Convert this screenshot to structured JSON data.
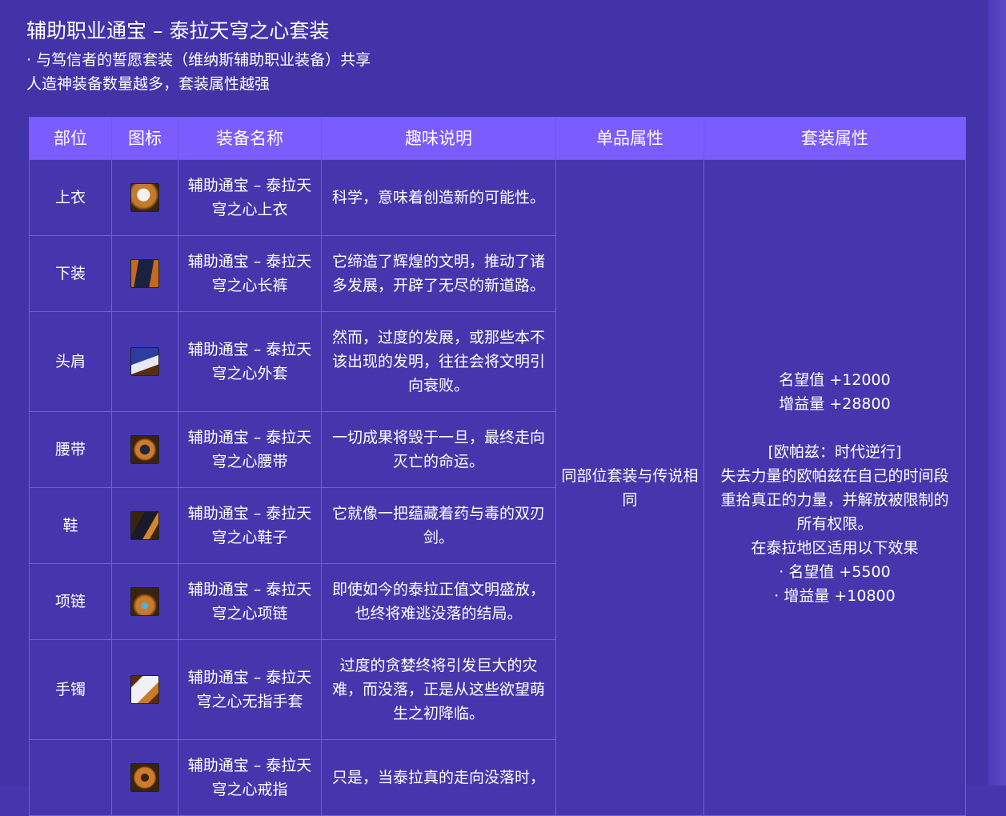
{
  "title": "辅助职业通宝 – 泰拉天穹之心套装",
  "subtitle_line1": "· 与笃信者的誓愿套装（维纳斯辅助职业装备）共享",
  "subtitle_line2": "人造神装备数量越多，套装属性越强",
  "table": {
    "headers": [
      "部位",
      "图标",
      "装备名称",
      "趣味说明",
      "单品属性",
      "套装属性"
    ],
    "rows": [
      {
        "slot": "上衣",
        "icon": "top-armor-icon",
        "name": "辅助通宝 – 泰拉天穹之心上衣",
        "desc": "科学，意味着创造新的可能性。"
      },
      {
        "slot": "下装",
        "icon": "pants-armor-icon",
        "name": "辅助通宝 – 泰拉天穹之心长裤",
        "desc": "它缔造了辉煌的文明，推动了诸多发展，开辟了无尽的新道路。"
      },
      {
        "slot": "头肩",
        "icon": "shoulder-armor-icon",
        "name": "辅助通宝 – 泰拉天穹之心外套",
        "desc": "然而，过度的发展，或那些本不该出现的发明，往往会将文明引向衰败。"
      },
      {
        "slot": "腰带",
        "icon": "belt-armor-icon",
        "name": "辅助通宝 – 泰拉天穹之心腰带",
        "desc": "一切成果将毁于一旦，最终走向灭亡的命运。"
      },
      {
        "slot": "鞋",
        "icon": "shoes-armor-icon",
        "name": "辅助通宝 – 泰拉天穹之心鞋子",
        "desc": "它就像一把蕴藏着药与毒的双刃剑。"
      },
      {
        "slot": "项链",
        "icon": "necklace-icon",
        "name": "辅助通宝 – 泰拉天穹之心项链",
        "desc": "即使如今的泰拉正值文明盛放，也终将难逃没落的结局。"
      },
      {
        "slot": "手镯",
        "icon": "bracelet-icon",
        "name": "辅助通宝 – 泰拉天穹之心无指手套",
        "desc": "过度的贪婪终将引发巨大的灾难，而没落，正是从这些欲望萌生之初降临。"
      },
      {
        "slot": "",
        "icon": "ring-icon",
        "name": "辅助通宝 – 泰拉天穹之心戒指",
        "desc": "只是，当泰拉真的走向没落时，"
      }
    ],
    "single_attr": "同部位套装与传说相同",
    "set_attr": {
      "line1": "名望值 +12000",
      "line2": "增益量 +28800",
      "line3": "[欧帕兹：时代逆行]",
      "line4": "失去力量的欧帕兹在自己的时间段重拾真正的力量，并解放被限制的所有权限。",
      "line5": "在泰拉地区适用以下效果",
      "line6": "· 名望值 +5500",
      "line7": "· 增益量 +10800"
    }
  },
  "colors": {
    "background": "#4233a9",
    "header_bg": "#7a5cff",
    "border": "#6e5ee0",
    "text": "#ffffff"
  }
}
